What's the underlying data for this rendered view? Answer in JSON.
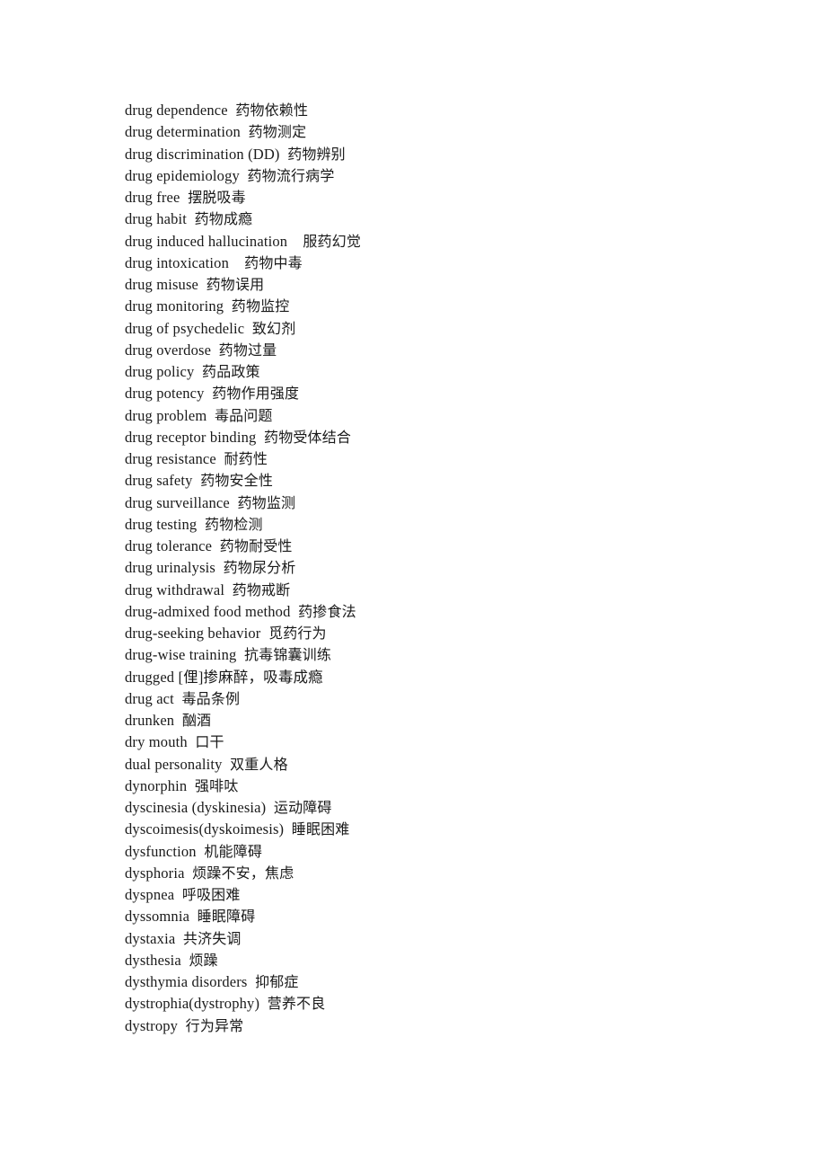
{
  "document": {
    "type": "bilingual-glossary-page",
    "language_pair": "English-Chinese",
    "background_color": "#ffffff",
    "text_color": "#1a1a1a",
    "entries": [
      {
        "term": "drug dependence",
        "sep": "  ",
        "gloss": "药物依赖性"
      },
      {
        "term": "drug determination",
        "sep": "  ",
        "gloss": "药物测定"
      },
      {
        "term": "drug discrimination (DD)",
        "sep": "  ",
        "gloss": "药物辨别"
      },
      {
        "term": "drug epidemiology",
        "sep": "  ",
        "gloss": "药物流行病学"
      },
      {
        "term": "drug free",
        "sep": "  ",
        "gloss": "摆脱吸毒"
      },
      {
        "term": "drug habit",
        "sep": "  ",
        "gloss": "药物成瘾"
      },
      {
        "term": "drug induced hallucination",
        "sep": "    ",
        "gloss": "服药幻觉"
      },
      {
        "term": "drug intoxication",
        "sep": "    ",
        "gloss": "药物中毒"
      },
      {
        "term": "drug misuse",
        "sep": "  ",
        "gloss": "药物误用"
      },
      {
        "term": "drug monitoring",
        "sep": "  ",
        "gloss": "药物监控"
      },
      {
        "term": "drug of psychedelic",
        "sep": "  ",
        "gloss": "致幻剂"
      },
      {
        "term": "drug overdose",
        "sep": "  ",
        "gloss": "药物过量"
      },
      {
        "term": "drug policy",
        "sep": "  ",
        "gloss": "药品政策"
      },
      {
        "term": "drug potency",
        "sep": "  ",
        "gloss": "药物作用强度"
      },
      {
        "term": "drug problem",
        "sep": "  ",
        "gloss": "毒品问题"
      },
      {
        "term": "drug receptor binding",
        "sep": "  ",
        "gloss": "药物受体结合"
      },
      {
        "term": "drug resistance",
        "sep": "  ",
        "gloss": "耐药性"
      },
      {
        "term": "drug safety",
        "sep": "  ",
        "gloss": "药物安全性"
      },
      {
        "term": "drug surveillance",
        "sep": "  ",
        "gloss": "药物监测"
      },
      {
        "term": "drug testing",
        "sep": "  ",
        "gloss": "药物检测"
      },
      {
        "term": "drug tolerance",
        "sep": "  ",
        "gloss": "药物耐受性"
      },
      {
        "term": "drug urinalysis",
        "sep": "  ",
        "gloss": "药物尿分析"
      },
      {
        "term": "drug withdrawal",
        "sep": "  ",
        "gloss": "药物戒断"
      },
      {
        "term": "drug-admixed food method",
        "sep": "  ",
        "gloss": "药掺食法"
      },
      {
        "term": "drug-seeking behavior",
        "sep": "  ",
        "gloss": "觅药行为"
      },
      {
        "term": "drug-wise training",
        "sep": "  ",
        "gloss": "抗毒锦囊训练"
      },
      {
        "term": "drugged [俚]掺麻醉，吸毒成瘾",
        "sep": "",
        "gloss": ""
      },
      {
        "term": "drug act",
        "sep": "  ",
        "gloss": "毒品条例"
      },
      {
        "term": "drunken",
        "sep": "  ",
        "gloss": "酗酒"
      },
      {
        "term": "dry mouth",
        "sep": "  ",
        "gloss": "口干"
      },
      {
        "term": "dual personality",
        "sep": "  ",
        "gloss": "双重人格"
      },
      {
        "term": "dynorphin",
        "sep": "  ",
        "gloss": "强啡呔"
      },
      {
        "term": "dyscinesia (dyskinesia)",
        "sep": "  ",
        "gloss": "运动障碍"
      },
      {
        "term": "dyscoimesis(dyskoimesis)",
        "sep": "  ",
        "gloss": "睡眠困难"
      },
      {
        "term": "dysfunction",
        "sep": "  ",
        "gloss": "机能障碍"
      },
      {
        "term": "dysphoria",
        "sep": "  ",
        "gloss": "烦躁不安，焦虑"
      },
      {
        "term": "dyspnea",
        "sep": "  ",
        "gloss": "呼吸困难"
      },
      {
        "term": "dyssomnia",
        "sep": "  ",
        "gloss": "睡眠障碍"
      },
      {
        "term": "dystaxia",
        "sep": "  ",
        "gloss": "共济失调"
      },
      {
        "term": "dysthesia",
        "sep": "  ",
        "gloss": "烦躁"
      },
      {
        "term": "dysthymia disorders",
        "sep": "  ",
        "gloss": "抑郁症"
      },
      {
        "term": "dystrophia(dystrophy)",
        "sep": "  ",
        "gloss": "营养不良"
      },
      {
        "term": "dystropy",
        "sep": "  ",
        "gloss": "行为异常"
      }
    ]
  }
}
